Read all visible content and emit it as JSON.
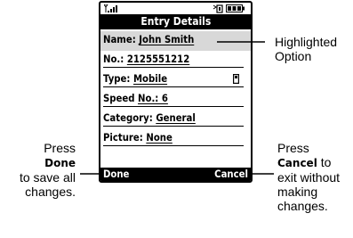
{
  "screen": {
    "title": "Entry Details",
    "rows": [
      {
        "label": "Name: ",
        "value": "John Smith"
      },
      {
        "label": "No.: ",
        "value": "2125551212"
      },
      {
        "label": "Type: ",
        "value": "Mobile",
        "icon": "mobile-phone-icon"
      },
      {
        "label": "Speed ",
        "value": "No.: 6"
      },
      {
        "label": "Category: ",
        "value": "General"
      },
      {
        "label": "Picture: ",
        "value": "None"
      }
    ],
    "highlight_color": "#d8d8d8",
    "softkey_left": "Done",
    "softkey_right": "Cancel",
    "status_icons": [
      "signal-strength-icon",
      "alert-icon",
      "battery-icon"
    ]
  },
  "callouts": {
    "highlighted": {
      "line1": "Highlighted",
      "line2": "Option"
    },
    "done": {
      "press": "Press",
      "key": "Done",
      "line3": "to save all",
      "line4": "changes."
    },
    "cancel": {
      "press": "Press",
      "key": "Cancel",
      "suffix": " to",
      "line3": "exit without",
      "line4": "making",
      "line5": "changes."
    }
  }
}
